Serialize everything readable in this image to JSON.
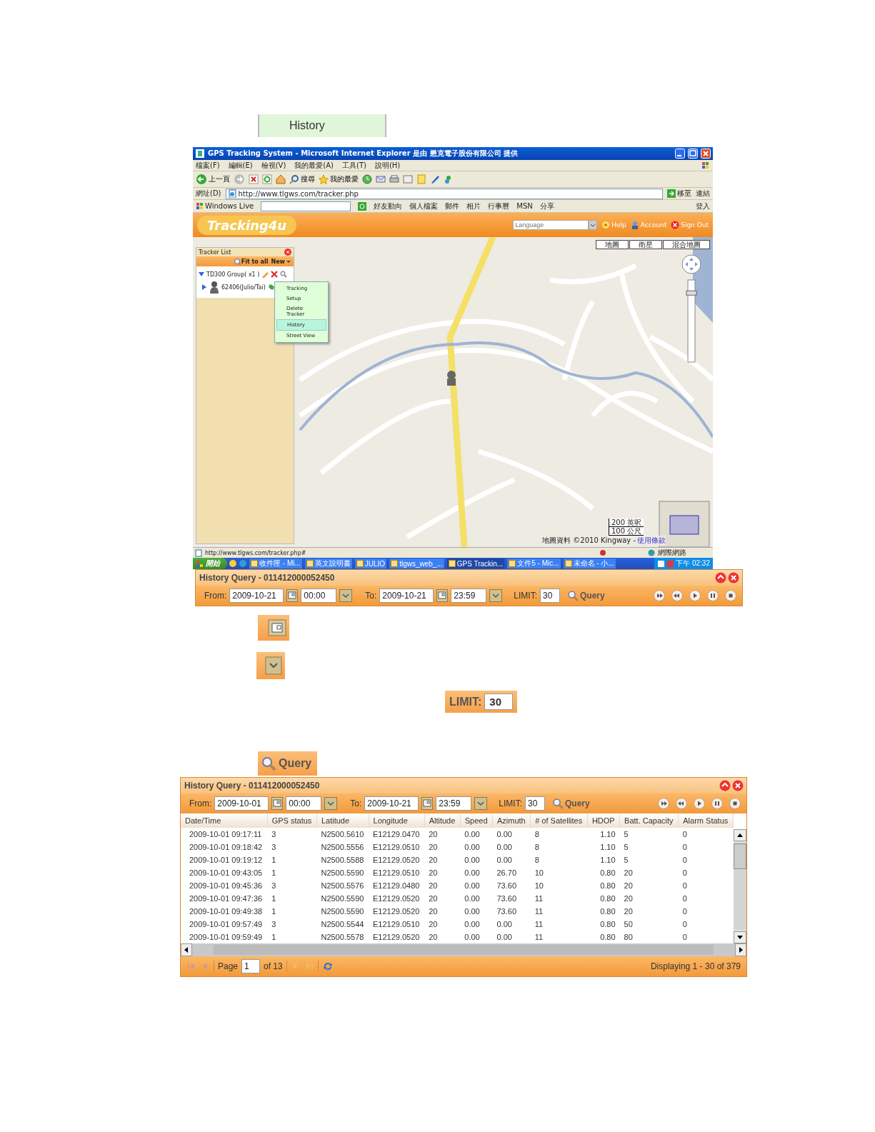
{
  "top_snippet": {
    "label": "History"
  },
  "browser": {
    "title": "GPS Tracking System - Microsoft Internet Explorer 是由 懋克電子股份有限公司 提供",
    "menu": [
      "檔案(F)",
      "編輯(E)",
      "檢視(V)",
      "我的最愛(A)",
      "工具(T)",
      "說明(H)"
    ],
    "toolbar": {
      "back": "上一頁",
      "search": "搜尋",
      "favorites": "我的最愛"
    },
    "address": {
      "label": "網址(D)",
      "url": "http://www.tlgws.com/tracker.php",
      "go": "移至",
      "links": "連結"
    },
    "links_bar": {
      "name": "Windows Live",
      "items": [
        "好友動向",
        "個人檔案",
        "郵件",
        "相片",
        "行事曆",
        "MSN",
        "分享"
      ],
      "signin": "登入"
    },
    "app": {
      "logo": "Tracking4u",
      "language_placeholder": "Language",
      "header_links": [
        "Help",
        "Account",
        "Sign Out"
      ],
      "tracker_list": {
        "title": "Tracker List",
        "fit": "Fit to all",
        "new": "New",
        "groups": [
          {
            "label": "TD300 Group( x1 )",
            "expanded": true,
            "children": [
              {
                "label": "62406(Julio/Tai)",
                "expanded": false
              }
            ]
          }
        ]
      },
      "context_menu": [
        {
          "label": "Tracking",
          "selected": false
        },
        {
          "label": "Setup",
          "selected": false
        },
        {
          "label": "Delete Tracker",
          "selected": false
        },
        {
          "label": "History",
          "selected": true
        },
        {
          "label": "Street View",
          "selected": false
        }
      ],
      "map": {
        "zoom": {
          "level": 0.86
        },
        "types": [
          "地圖",
          "衛星",
          "混合地圖"
        ],
        "scale": [
          "200 英呎",
          "100 公尺"
        ],
        "attribution": "地圖資料 ©2010 Kingway - ",
        "terms": "使用條款"
      }
    },
    "status": {
      "url": "http://www.tlgws.com/tracker.php#",
      "zone": "網際網路"
    },
    "taskbar": {
      "start": "開始",
      "tasks": [
        {
          "label": "收件匣 - Mi...",
          "selected": false
        },
        {
          "label": "英文說明書",
          "selected": false
        },
        {
          "label": "JULIO",
          "selected": false
        },
        {
          "label": "tlgws_web_...",
          "selected": false
        },
        {
          "label": "GPS Trackin...",
          "selected": true
        },
        {
          "label": "文件5 - Mic...",
          "selected": false
        },
        {
          "label": "未命名 - 小...",
          "selected": false
        }
      ],
      "clock": "下午 02:32"
    }
  },
  "history_bar": {
    "title": "History Query - 011412000052450",
    "from_label": "From:",
    "from_date": "2009-10-21",
    "from_time": "00:00",
    "to_label": "To:",
    "to_date": "2009-10-21",
    "to_time": "23:59",
    "limit_label": "LIMIT:",
    "limit": "30",
    "query": "Query"
  },
  "limit_snippet": {
    "label": "LIMIT:",
    "value": "30"
  },
  "query_snippet": {
    "label": "Query"
  },
  "history_window": {
    "title": "History Query - 011412000052450",
    "from_label": "From:",
    "from_date": "2009-10-01",
    "from_time": "00:00",
    "to_label": "To:",
    "to_date": "2009-10-21",
    "to_time": "23:59",
    "limit_label": "LIMIT:",
    "limit": "30",
    "query": "Query",
    "columns": [
      "Date/Time",
      "GPS status",
      "Latitude",
      "Longitude",
      "Altitude",
      "Speed",
      "Azimuth",
      "# of Satellites",
      "HDOP",
      "Batt. Capacity",
      "Alarm Status"
    ],
    "rows": [
      [
        "2009-10-01 09:17:11",
        "3",
        "N2500.5610",
        "E12129.0470",
        "20",
        "0.00",
        "0.00",
        "8",
        "1.10",
        "5",
        "0"
      ],
      [
        "2009-10-01 09:18:42",
        "3",
        "N2500.5556",
        "E12129.0510",
        "20",
        "0.00",
        "0.00",
        "8",
        "1.10",
        "5",
        "0"
      ],
      [
        "2009-10-01 09:19:12",
        "1",
        "N2500.5588",
        "E12129.0520",
        "20",
        "0.00",
        "0.00",
        "8",
        "1.10",
        "5",
        "0"
      ],
      [
        "2009-10-01 09:43:05",
        "1",
        "N2500.5590",
        "E12129.0510",
        "20",
        "0.00",
        "26.70",
        "10",
        "0.80",
        "20",
        "0"
      ],
      [
        "2009-10-01 09:45:36",
        "3",
        "N2500.5576",
        "E12129.0480",
        "20",
        "0.00",
        "73.60",
        "10",
        "0.80",
        "20",
        "0"
      ],
      [
        "2009-10-01 09:47:36",
        "1",
        "N2500.5590",
        "E12129.0520",
        "20",
        "0.00",
        "73.60",
        "11",
        "0.80",
        "20",
        "0"
      ],
      [
        "2009-10-01 09:49:38",
        "1",
        "N2500.5590",
        "E12129.0520",
        "20",
        "0.00",
        "73.60",
        "11",
        "0.80",
        "20",
        "0"
      ],
      [
        "2009-10-01 09:57:49",
        "3",
        "N2500.5544",
        "E12129.0510",
        "20",
        "0.00",
        "0.00",
        "11",
        "0.80",
        "50",
        "0"
      ],
      [
        "2009-10-01 09:59:49",
        "1",
        "N2500.5578",
        "E12129.0520",
        "20",
        "0.00",
        "0.00",
        "11",
        "0.80",
        "80",
        "0"
      ]
    ],
    "pager": {
      "page_label": "Page",
      "page": "1",
      "of": "of 13",
      "display": "Displaying 1 - 30 of 379"
    }
  }
}
